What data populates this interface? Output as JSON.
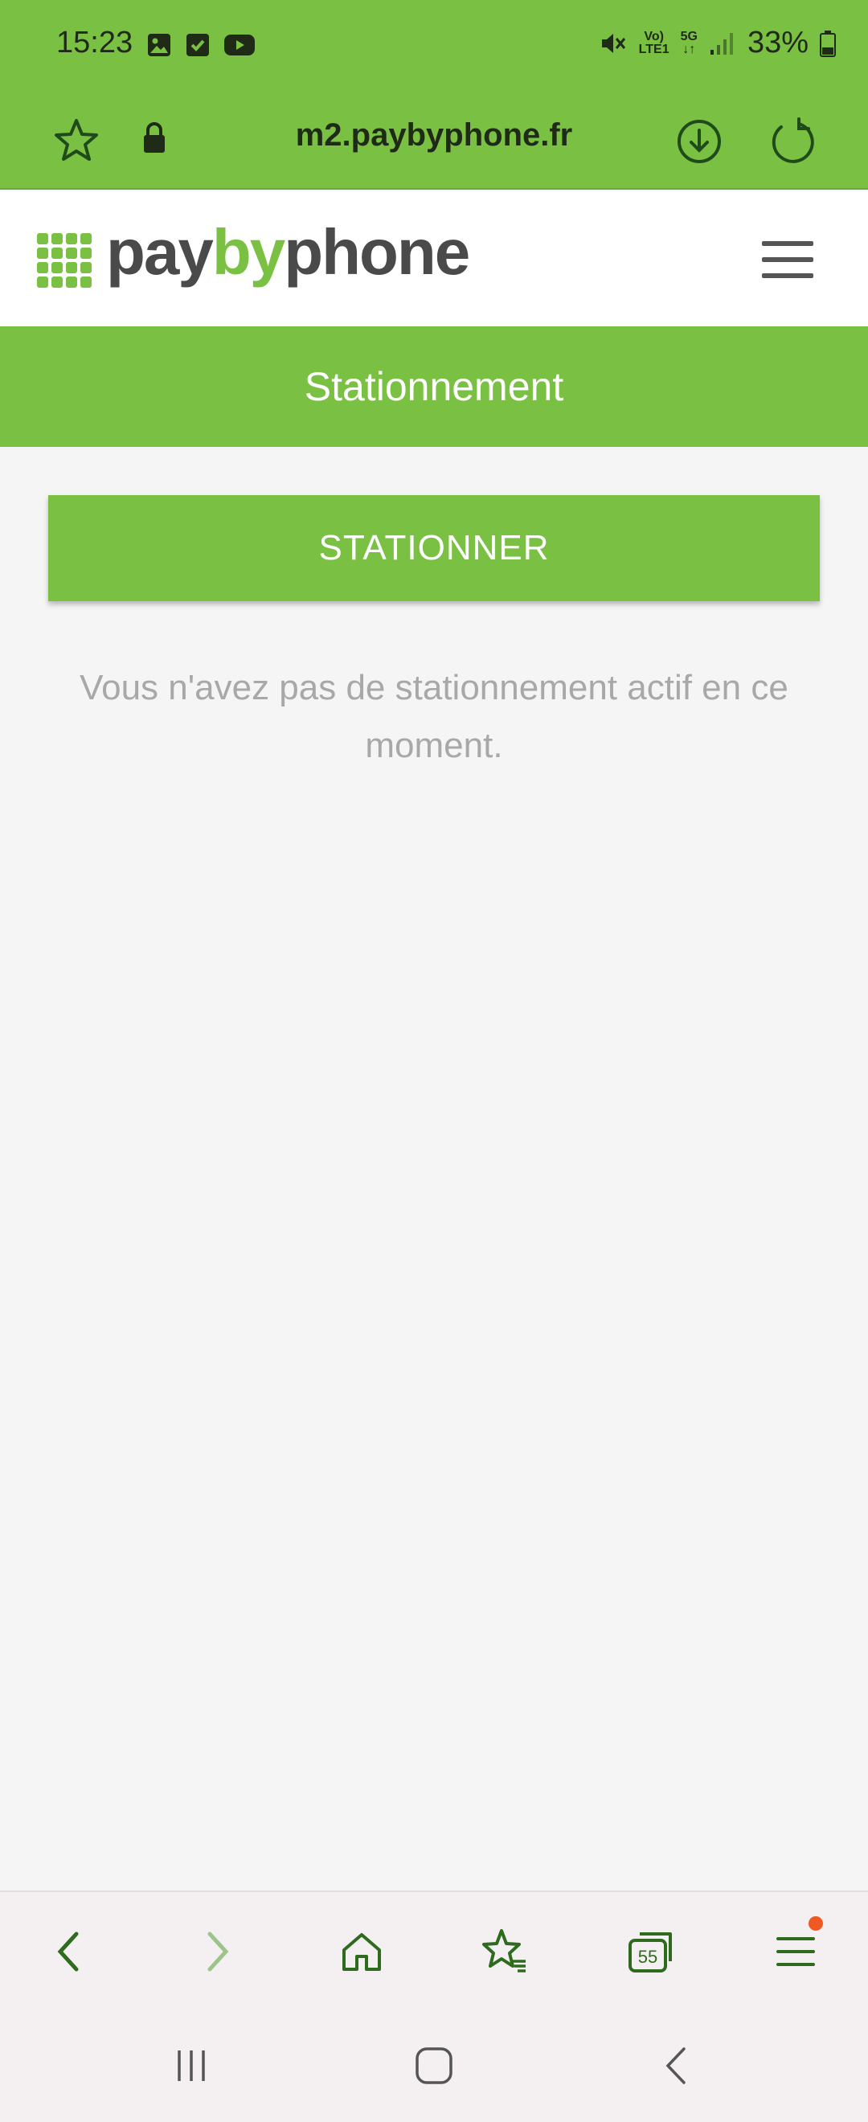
{
  "status_bar": {
    "time": "15:23",
    "battery": "33%",
    "network_top": "Vo)",
    "network_bottom": "LTE1",
    "network_5g": "5G"
  },
  "browser": {
    "url": "m2.paybyphone.fr",
    "tab_count": "55"
  },
  "header": {
    "logo_part1": "pay",
    "logo_part2": "by",
    "logo_part3": "phone"
  },
  "section": {
    "title": "Stationnement"
  },
  "main": {
    "park_button_label": "STATIONNER",
    "empty_message": "Vous n'avez pas de stationnement actif en ce moment."
  },
  "colors": {
    "brand_green": "#7ac143",
    "logo_gray": "#4a4a4a",
    "notification_orange": "#ef5a22"
  }
}
